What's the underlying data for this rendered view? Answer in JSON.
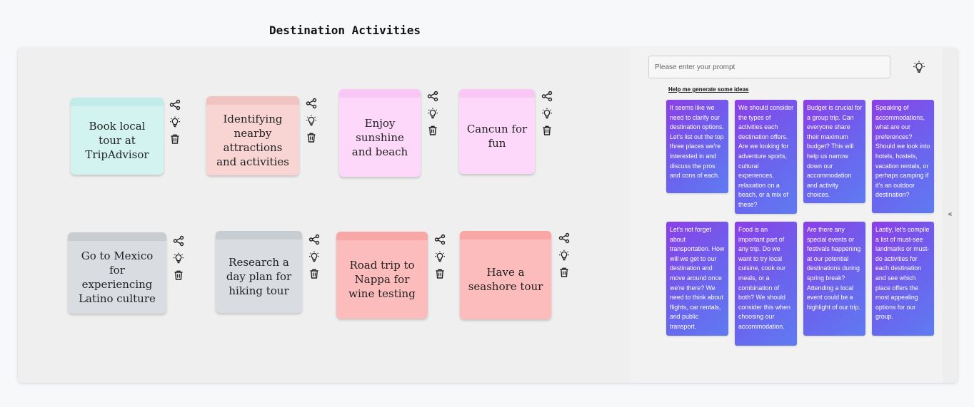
{
  "title": "Destination Activities",
  "notes": [
    {
      "text": "Book local tour at TripAdvisor",
      "color": "#d3f3f1",
      "tab": "#c2ece9"
    },
    {
      "text": "Identifying nearby attractions and activities",
      "color": "#f8d5d3",
      "tab": "#f2c4c1"
    },
    {
      "text": "Enjoy sunshine and beach",
      "color": "#fdd8fb",
      "tab": "#f9c6f6"
    },
    {
      "text": "Cancun for fun",
      "color": "#fdd8fb",
      "tab": "#f9c6f6"
    },
    {
      "text": "Go to Mexico for experiencing Latino culture",
      "color": "#d9dde1",
      "tab": "#c8cdd2"
    },
    {
      "text": "Research a day plan for hiking tour",
      "color": "#d9dde1",
      "tab": "#c8cdd2"
    },
    {
      "text": "Road trip to Nappa for wine testing",
      "color": "#fcbcbc",
      "tab": "#f9a6a6"
    },
    {
      "text": "Have a seashore tour",
      "color": "#fcbcbc",
      "tab": "#f9a6a6"
    }
  ],
  "note_tools": [
    "share-icon",
    "lightbulb-icon",
    "trash-icon"
  ],
  "prompt": {
    "placeholder": "Please enter your prompt",
    "value": "",
    "icon": "lightbulb-icon"
  },
  "help_link": "Help me generate some ideas",
  "ideas": [
    "It seems like we need to clarify our destination options. Let's list out the top three places we're interested in and discuss the pros and cons of each.",
    "We should consider the types of activities each destination offers. Are we looking for adventure sports, cultural experiences, relaxation on a beach, or a mix of these?",
    "Budget is crucial for a group trip. Can everyone share their maximum budget? This will help us narrow down our accommodation and activity choices.",
    "Speaking of accommodations, what are our preferences? Should we look into hotels, hostels, vacation rentals, or perhaps camping if it's an outdoor destination?",
    "Let's not forget about transportation. How will we get to our destination and move around once we're there? We need to think about flights, car rentals, and public transport.",
    "Food is an important part of any trip. Do we want to try local cuisine, cook our meals, or a combination of both? We should consider this when choosing our accommodation.",
    "Are there any special events or festivals happening at our potential destinations during spring break? Attending a local event could be a highlight of our trip.",
    "Lastly, let's compile a list of must-see landmarks or must-do activities for each destination and see which place offers the most appealing options for our group."
  ],
  "collapse_label": "«"
}
